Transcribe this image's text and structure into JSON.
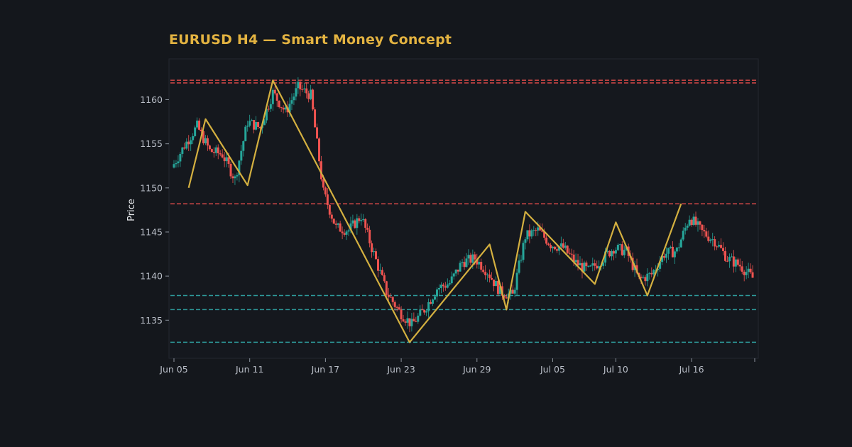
{
  "chart_data": {
    "type": "candlestick",
    "title": "EURUSD H4 — Smart Money Concept",
    "xlabel": "",
    "ylabel": "Price",
    "xlim": [
      "2025-06-05",
      "2025-07-21"
    ],
    "ylim": [
      1131.0,
      1163.5
    ],
    "x_ticks": [
      "Jun 05",
      "Jun 11",
      "Jun 17",
      "Jun 23",
      "Jun 29",
      "Jul 05",
      "Jul 10",
      "Jul 16"
    ],
    "y_ticks": [
      1135,
      1140,
      1145,
      1150,
      1155,
      1160
    ],
    "grid": false,
    "colors": {
      "background": "#14171c",
      "plot_background": "#15181e",
      "up": "#26a69a",
      "down": "#ef5350",
      "zigzag": "#d4b040",
      "resistance": "#d64848",
      "support": "#2e9b9b",
      "title": "#e3b341"
    },
    "candle_anchors": [
      {
        "x": "2025-06-05",
        "close": 1152.3
      },
      {
        "x": "2025-06-06",
        "close": 1154.8
      },
      {
        "x": "2025-06-07",
        "close": 1157.0
      },
      {
        "x": "2025-06-08",
        "close": 1154.2
      },
      {
        "x": "2025-06-09",
        "close": 1153.8
      },
      {
        "x": "2025-06-10",
        "close": 1151.0
      },
      {
        "x": "2025-06-11",
        "close": 1157.5
      },
      {
        "x": "2025-06-12",
        "close": 1156.8
      },
      {
        "x": "2025-06-13",
        "close": 1160.8
      },
      {
        "x": "2025-06-14",
        "close": 1158.6
      },
      {
        "x": "2025-06-15",
        "close": 1161.4
      },
      {
        "x": "2025-06-16",
        "close": 1160.5
      },
      {
        "x": "2025-06-17",
        "close": 1149.5
      },
      {
        "x": "2025-06-18",
        "close": 1145.5
      },
      {
        "x": "2025-06-19",
        "close": 1145.2
      },
      {
        "x": "2025-06-20",
        "close": 1146.8
      },
      {
        "x": "2025-06-21",
        "close": 1142.5
      },
      {
        "x": "2025-06-22",
        "close": 1138.2
      },
      {
        "x": "2025-06-23",
        "close": 1136.0
      },
      {
        "x": "2025-06-24",
        "close": 1134.5
      },
      {
        "x": "2025-06-25",
        "close": 1136.2
      },
      {
        "x": "2025-06-26",
        "close": 1138.6
      },
      {
        "x": "2025-06-27",
        "close": 1139.2
      },
      {
        "x": "2025-06-28",
        "close": 1141.6
      },
      {
        "x": "2025-06-29",
        "close": 1142.0
      },
      {
        "x": "2025-06-30",
        "close": 1140.5
      },
      {
        "x": "2025-07-01",
        "close": 1138.2
      },
      {
        "x": "2025-07-02",
        "close": 1137.8
      },
      {
        "x": "2025-07-03",
        "close": 1144.5
      },
      {
        "x": "2025-07-04",
        "close": 1145.2
      },
      {
        "x": "2025-07-05",
        "close": 1143.6
      },
      {
        "x": "2025-07-06",
        "close": 1143.2
      },
      {
        "x": "2025-07-07",
        "close": 1141.5
      },
      {
        "x": "2025-07-08",
        "close": 1140.6
      },
      {
        "x": "2025-07-09",
        "close": 1141.8
      },
      {
        "x": "2025-07-10",
        "close": 1143.2
      },
      {
        "x": "2025-07-11",
        "close": 1142.8
      },
      {
        "x": "2025-07-12",
        "close": 1139.6
      },
      {
        "x": "2025-07-13",
        "close": 1140.2
      },
      {
        "x": "2025-07-14",
        "close": 1142.5
      },
      {
        "x": "2025-07-15",
        "close": 1142.9
      },
      {
        "x": "2025-07-16",
        "close": 1146.7
      },
      {
        "x": "2025-07-17",
        "close": 1145.0
      },
      {
        "x": "2025-07-18",
        "close": 1144.0
      },
      {
        "x": "2025-07-19",
        "close": 1142.0
      },
      {
        "x": "2025-07-20",
        "close": 1141.2
      },
      {
        "x": "2025-07-21",
        "close": 1139.8
      }
    ],
    "zigzag": [
      {
        "x": "2025-06-06T04:00",
        "y": 1150.0
      },
      {
        "x": "2025-06-07T12:00",
        "y": 1157.8
      },
      {
        "x": "2025-06-10T20:00",
        "y": 1150.3
      },
      {
        "x": "2025-06-12T20:00",
        "y": 1162.2
      },
      {
        "x": "2025-06-23T16:00",
        "y": 1132.5
      },
      {
        "x": "2025-06-30T00:00",
        "y": 1143.6
      },
      {
        "x": "2025-07-01T08:00",
        "y": 1136.2
      },
      {
        "x": "2025-07-02T20:00",
        "y": 1147.3
      },
      {
        "x": "2025-07-08T08:00",
        "y": 1139.1
      },
      {
        "x": "2025-07-10T00:00",
        "y": 1146.1
      },
      {
        "x": "2025-07-12T12:00",
        "y": 1137.8
      },
      {
        "x": "2025-07-15T04:00",
        "y": 1148.2
      }
    ],
    "horizontal_levels": [
      {
        "kind": "resistance",
        "y": 1162.2
      },
      {
        "kind": "resistance",
        "y": 1161.9
      },
      {
        "kind": "resistance",
        "y": 1148.2
      },
      {
        "kind": "support",
        "y": 1137.8
      },
      {
        "kind": "support",
        "y": 1136.2
      },
      {
        "kind": "support",
        "y": 1132.5
      }
    ]
  }
}
